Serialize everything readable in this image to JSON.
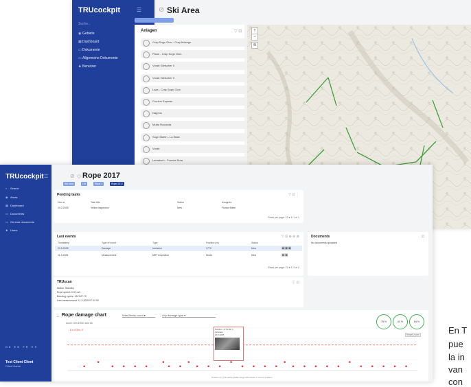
{
  "back_window": {
    "brand": "TRUcockpit",
    "search_placeholder": "Suche...",
    "nav": [
      {
        "icon": "map-pin-icon",
        "label": "Gebiete"
      },
      {
        "icon": "grid-icon",
        "label": "Dashboard"
      },
      {
        "icon": "document-icon",
        "label": "Dokumente"
      },
      {
        "icon": "folder-icon",
        "label": "Allgemeine Dokumente"
      },
      {
        "icon": "user-icon",
        "label": "Benutzer"
      }
    ],
    "title": "Ski Area",
    "panel_title": "Anlagen",
    "lifts": [
      "Crap Sogn Gion - Crap Masegn",
      "Plaun - Crap Sogn Gion",
      "Vorab Gletscher II",
      "Vorab Gletscher II",
      "Laax - Crap Sogn Gion",
      "Curnius Express",
      "Nagens",
      "Mutta Rodunda",
      "Sogn Martin - La Siala",
      "Vorab",
      "Larnatsch - Fuorcla Sura"
    ]
  },
  "front_window": {
    "brand": "TRUcockpit",
    "nav": [
      {
        "icon": "search-icon",
        "label": "Search"
      },
      {
        "icon": "map-pin-icon",
        "label": "Areas"
      },
      {
        "icon": "grid-icon",
        "label": "Dashboard"
      },
      {
        "icon": "document-icon",
        "label": "Documents"
      },
      {
        "icon": "folder-icon",
        "label": "General documents"
      },
      {
        "icon": "user-icon",
        "label": "Users"
      }
    ],
    "languages": "DE EN FR ES",
    "user_name": "Test Client Client",
    "user_sub": "Client Name",
    "page_title": "Rope 2017",
    "breadcrumb": [
      "Ski Area",
      "Lift",
      "Rope 1",
      "Rope 2017"
    ],
    "pending_tasks": {
      "title": "Pending tasks",
      "columns": [
        "Due at",
        "Task title",
        "Status",
        "Assignee"
      ],
      "row": [
        "19.2.2025",
        "Yellow inspection",
        "New",
        "Florian Meier"
      ],
      "pagination": "Rows per page: 10 ▾   1–1 of 1"
    },
    "last_events": {
      "title": "Last events",
      "columns": [
        "Timestamp",
        "Type of event",
        "Type",
        "Position (m)",
        "Status"
      ],
      "rows": [
        [
          "20.5.2025",
          "Damage",
          "Inclusion",
          "1779",
          "New"
        ],
        [
          "11.3.2025",
          "Measurement",
          "MRT inspection",
          "Shots",
          "New"
        ]
      ],
      "pagination": "Rows per page: 10 ▾   1–2 of 2"
    },
    "documents": {
      "title": "Documents",
      "empty": "No documents uploaded"
    },
    "truscan": {
      "title": "TRUscan",
      "lines": [
        "Status: Standby",
        "Rope speed: 0.00 m/s",
        "Bending cycles: 134'547.79",
        "Last measurement: 11.3.2025 07:12:00"
      ]
    },
    "chart": {
      "title": "Rope damage chart",
      "filter1": "Wire Break count",
      "filter2": "Any damage type",
      "zoom": "Zoom  10m  100m  1km  All",
      "reset": "Reset zoom",
      "threshold_label": "6 x d Grlv. II",
      "tooltip": [
        "Position: 1779.86 m",
        "Inclusion",
        "20.5.2025"
      ],
      "footer": "Position (m) | No active stable range with shown in current position",
      "gauges": [
        "75 %",
        "63 %",
        "84 %"
      ]
    }
  },
  "overlay_text": [
    "En T",
    "pue",
    "la in",
    "van",
    "con"
  ],
  "chart_data": {
    "type": "scatter",
    "title": "Rope damage chart",
    "xlabel": "",
    "ylabel": "",
    "x": [
      300,
      550,
      800,
      1000,
      1200,
      1400,
      1700,
      1800,
      2000,
      2150,
      2300,
      2500,
      2700,
      2900,
      3100,
      3300,
      3500,
      3700,
      3850,
      4000,
      4200,
      4400,
      4600,
      4800,
      5000,
      5200,
      5400,
      5600,
      5800,
      6000
    ],
    "values": [
      1,
      2,
      1,
      1,
      1,
      1,
      2,
      1,
      1,
      2,
      1,
      1,
      1,
      2,
      1,
      1,
      1,
      1,
      2,
      1,
      1,
      1,
      1,
      1,
      2,
      1,
      1,
      1,
      1,
      1
    ],
    "threshold": 6,
    "ylim": [
      0,
      10
    ],
    "colors": {
      "points": "#e53935",
      "threshold": "#e53935"
    }
  },
  "colors": {
    "sidebar": "#1f3f9a",
    "accent": "#7fa0e8",
    "gauge_green": "#3fae49",
    "danger": "#e53935"
  }
}
